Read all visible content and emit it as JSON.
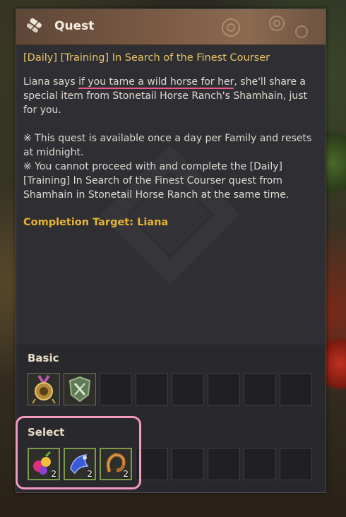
{
  "window": {
    "title": "Quest",
    "icon": "scroll-icon"
  },
  "quest": {
    "title": "[Daily] [Training] In Search of the Finest Courser",
    "desc_p1_before": "Liana says ",
    "desc_p1_highlight": "if you tame a wild horse for her",
    "desc_p1_after": ", she'll share a special item from Stonetail Horse Ranch's Shamhain, just for you.",
    "note_1": "※ This quest is available once a day per Family and resets at midnight.",
    "note_2": "※ You cannot proceed with and complete the [Daily] [Training] In Search of the Finest Courser quest from Shamhain in Stonetail Horse Ranch at the same time.",
    "completion": "Completion Target: Liana"
  },
  "rewards": {
    "basic_label": "Basic",
    "basic_items": [
      {
        "icon": "medal-icon"
      },
      {
        "icon": "skill-shield-icon"
      }
    ],
    "select_label": "Select",
    "select_items": [
      {
        "icon": "potion-bundle-icon",
        "count": "2"
      },
      {
        "icon": "blue-horn-icon",
        "count": "2"
      },
      {
        "icon": "horseshoe-rope-icon",
        "count": "2"
      }
    ]
  },
  "colors": {
    "title_gold": "#e8c468",
    "completion_gold": "#e8b430",
    "highlight_pink": "#f29ac0",
    "underline_pink": "#e65a8c"
  }
}
